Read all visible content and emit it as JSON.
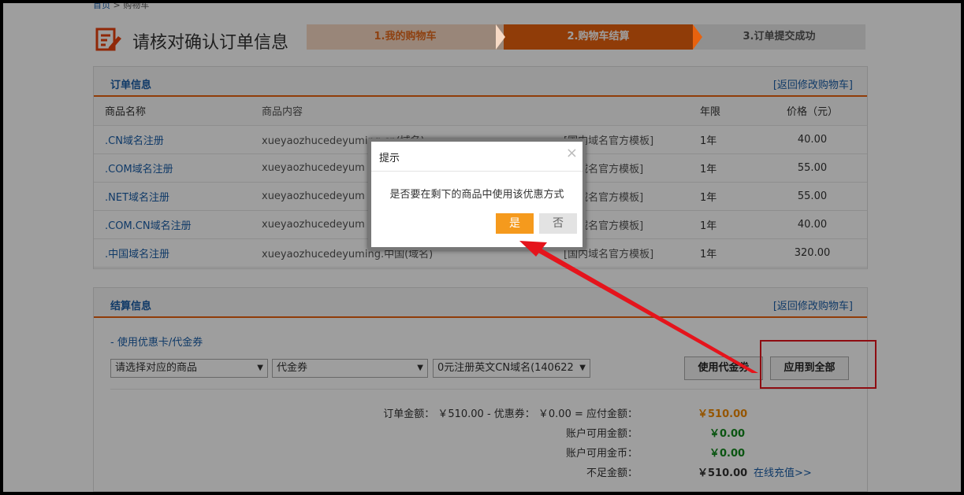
{
  "breadcrumb": {
    "home": "首页",
    "sep": ">",
    "current": "购物车"
  },
  "page": {
    "title": "请核对确认订单信息"
  },
  "steps": [
    {
      "label": "1.我的购物车"
    },
    {
      "label": "2.购物车结算"
    },
    {
      "label": "3.订单提交成功"
    }
  ],
  "order": {
    "title": "订单信息",
    "back_link": "[返回修改购物车]",
    "columns": [
      "商品名称",
      "商品内容",
      "",
      "年限",
      "价格（元）"
    ],
    "rows": [
      {
        "name": ".CN域名注册",
        "content": "xueyaozhucedeyuming.cn(域名)",
        "template": "[国内域名官方模板]",
        "years": "1年",
        "price": "40.00"
      },
      {
        "name": ".COM域名注册",
        "content": "xueyaozhucedeyum",
        "template": "[际域名官方模板]",
        "years": "1年",
        "price": "55.00"
      },
      {
        "name": ".NET域名注册",
        "content": "xueyaozhucedeyum",
        "template": "[际域名官方模板]",
        "years": "1年",
        "price": "55.00"
      },
      {
        "name": ".COM.CN域名注册",
        "content": "xueyaozhucedeyum",
        "template": "[内域名官方模板]",
        "years": "1年",
        "price": "40.00"
      },
      {
        "name": ".中国域名注册",
        "content": "xueyaozhucedeyuming.中国(域名)",
        "template": "[国内域名官方模板]",
        "years": "1年",
        "price": "320.00"
      }
    ]
  },
  "settle": {
    "title": "结算信息",
    "back_link": "[返回修改购物车]",
    "coupon_title": "- 使用优惠卡/代金券",
    "select_product": "请选择对应的商品",
    "select_type": "代金券",
    "select_coupon": "0元注册英文CN域名(140622",
    "btn_use_voucher": "使用代金券",
    "btn_apply_all": "应用到全部",
    "summary": {
      "order_line": "订单金额： ￥510.00  -  优惠券： ￥0.00 = 应付金额：",
      "payable": "￥510.00",
      "balance_label": "账户可用金额：",
      "balance": "￥0.00",
      "coins_label": "账户可用金币：",
      "coins": "￥0.00",
      "shortfall_label": "不足金额：",
      "shortfall": "￥510.00",
      "recharge": "在线充值>>"
    }
  },
  "dialog": {
    "title": "提示",
    "close": "×",
    "message": "是否要在剩下的商品中使用该优惠方式",
    "yes": "是",
    "no": "否"
  },
  "colors": {
    "accent": "#e8620e",
    "link": "#1a5ea8",
    "highlight_box": "#e5141c",
    "yes_button": "#f59a1d"
  }
}
